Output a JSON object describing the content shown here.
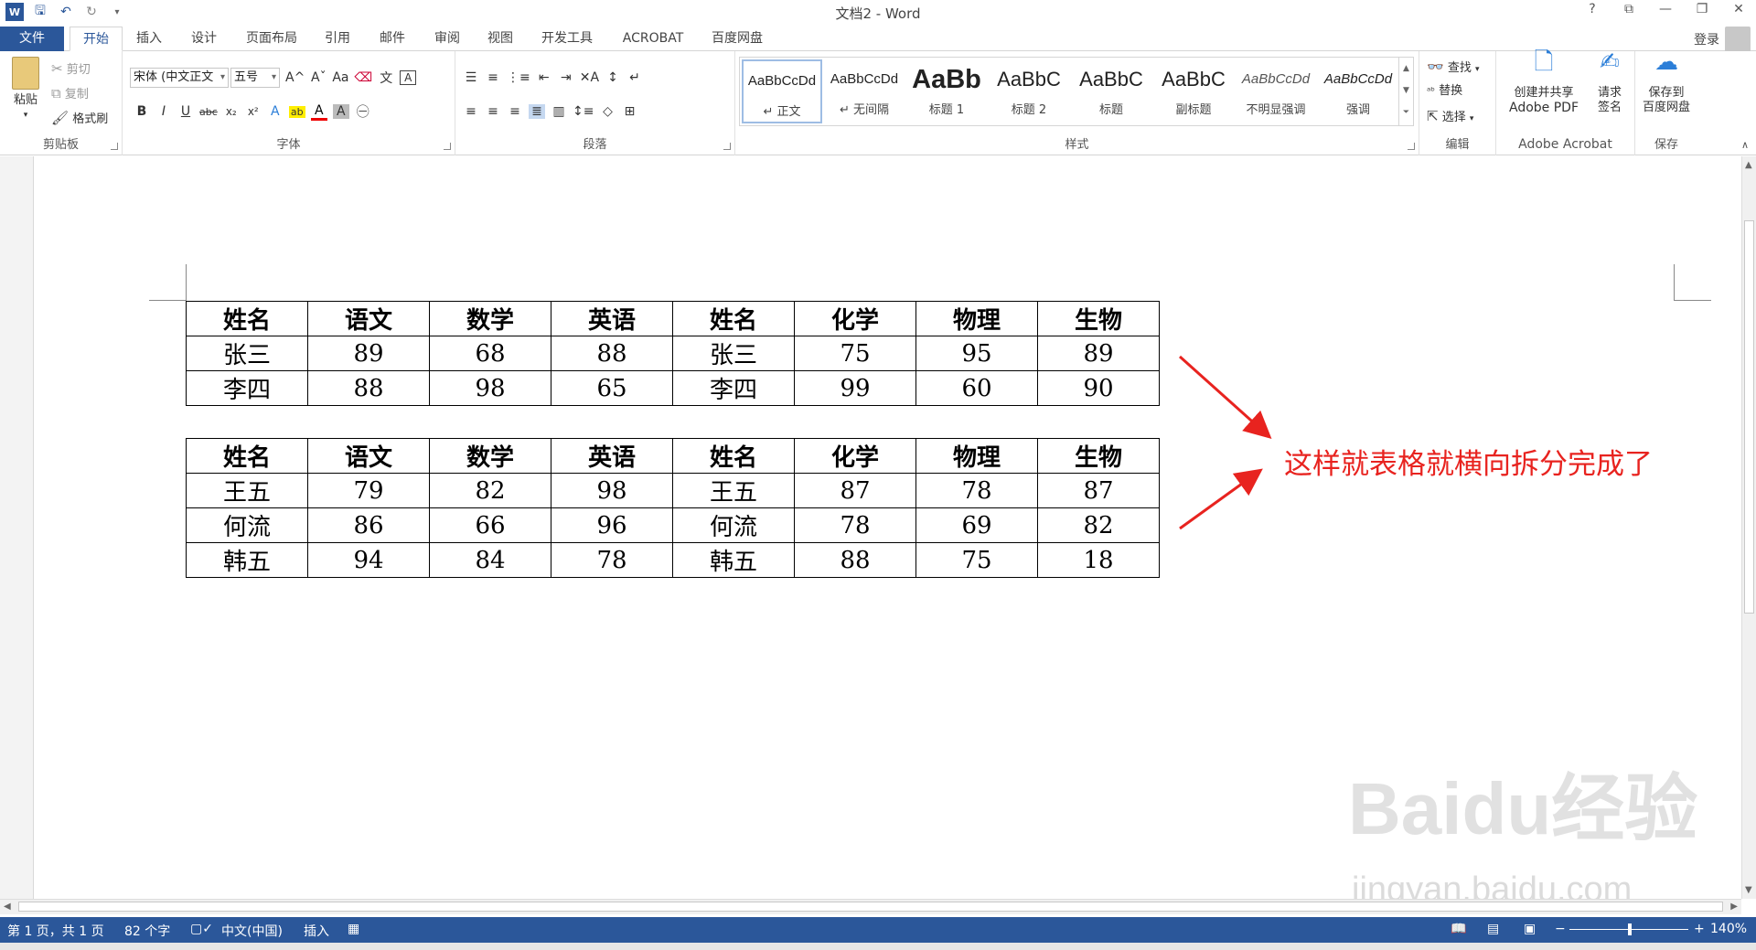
{
  "app": {
    "title": "文档2 - Word",
    "login": "登录"
  },
  "tabs": [
    {
      "label": "文件"
    },
    {
      "label": "开始"
    },
    {
      "label": "插入"
    },
    {
      "label": "设计"
    },
    {
      "label": "页面布局"
    },
    {
      "label": "引用"
    },
    {
      "label": "邮件"
    },
    {
      "label": "审阅"
    },
    {
      "label": "视图"
    },
    {
      "label": "开发工具"
    },
    {
      "label": "ACROBAT"
    },
    {
      "label": "百度网盘"
    }
  ],
  "clipboard": {
    "paste": "粘贴",
    "cut": "剪切",
    "copy": "复制",
    "format_painter": "格式刷",
    "label": "剪贴板"
  },
  "font": {
    "name": "宋体 (中文正文",
    "size": "五号",
    "label": "字体",
    "aa": "Aa"
  },
  "paragraph": {
    "label": "段落"
  },
  "styles": {
    "label": "样式",
    "items": [
      {
        "sample": "AaBbCcDd",
        "name": "↵ 正文"
      },
      {
        "sample": "AaBbCcDd",
        "name": "↵ 无间隔"
      },
      {
        "sample": "AaBb",
        "name": "标题 1"
      },
      {
        "sample": "AaBbC",
        "name": "标题 2"
      },
      {
        "sample": "AaBbC",
        "name": "标题"
      },
      {
        "sample": "AaBbC",
        "name": "副标题"
      },
      {
        "sample": "AaBbCcDd",
        "name": "不明显强调"
      },
      {
        "sample": "AaBbCcDd",
        "name": "强调"
      }
    ]
  },
  "editing": {
    "find": "查找",
    "replace": "替换",
    "select": "选择",
    "label": "编辑"
  },
  "acrobat": {
    "create": "创建并共享",
    "create2": "Adobe PDF",
    "sign": "请求",
    "sign2": "签名",
    "label": "Adobe Acrobat"
  },
  "save": {
    "save": "保存到",
    "save2": "百度网盘",
    "label": "保存"
  },
  "table1": {
    "header": [
      "姓名",
      "语文",
      "数学",
      "英语",
      "姓名",
      "化学",
      "物理",
      "生物"
    ],
    "rows": [
      [
        "张三",
        "89",
        "68",
        "88",
        "张三",
        "75",
        "95",
        "89"
      ],
      [
        "李四",
        "88",
        "98",
        "65",
        "李四",
        "99",
        "60",
        "90"
      ]
    ]
  },
  "table2": {
    "header": [
      "姓名",
      "语文",
      "数学",
      "英语",
      "姓名",
      "化学",
      "物理",
      "生物"
    ],
    "rows": [
      [
        "王五",
        "79",
        "82",
        "98",
        "王五",
        "87",
        "78",
        "87"
      ],
      [
        "何流",
        "86",
        "66",
        "96",
        "何流",
        "78",
        "69",
        "82"
      ],
      [
        "韩五",
        "94",
        "84",
        "78",
        "韩五",
        "88",
        "75",
        "18"
      ]
    ]
  },
  "annotation": "这样就表格就横向拆分完成了",
  "status": {
    "page": "第 1 页，共 1 页",
    "words": "82 个字",
    "lang": "中文(中国)",
    "mode": "插入",
    "zoom": "140%"
  },
  "watermark": {
    "logo": "Baidu经验",
    "url": "jingyan.baidu.com"
  },
  "colors": {
    "accent": "#2b579a",
    "annotation": "#e8231f"
  }
}
